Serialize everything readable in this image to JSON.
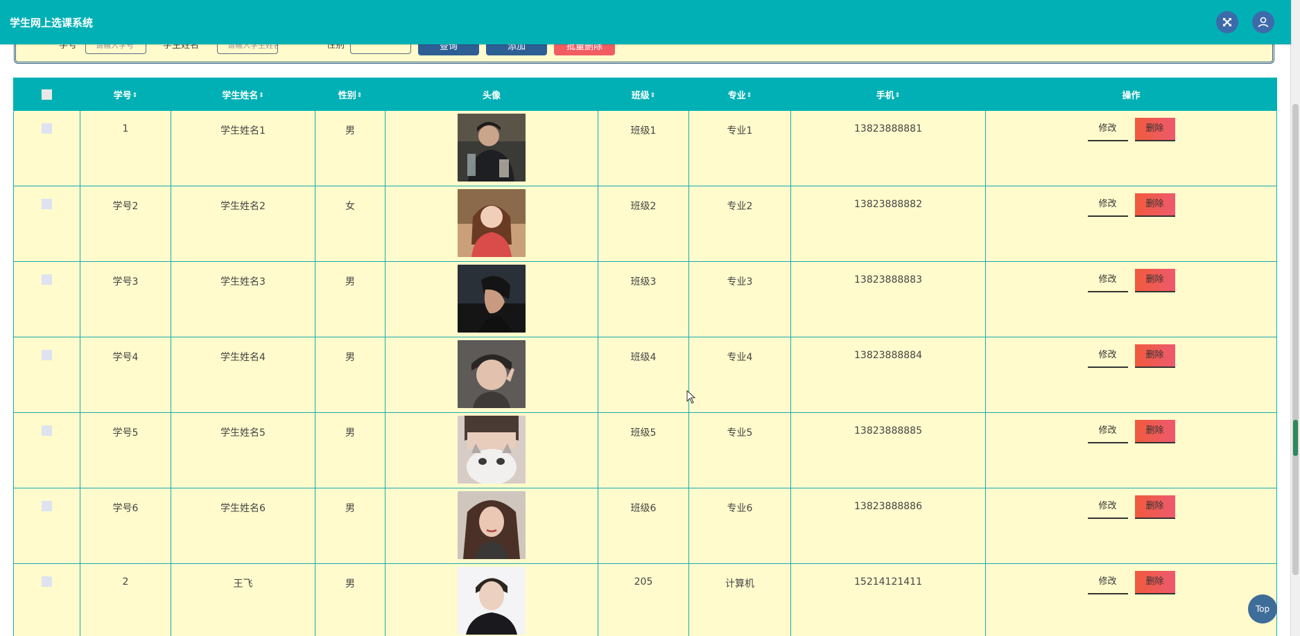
{
  "app": {
    "title": "学生网上选课系统"
  },
  "header": {
    "fullscreen_icon": "expand-icon",
    "user_icon": "user-icon",
    "accent_color": "#00b0b5"
  },
  "search": {
    "student_id_label": "学号",
    "student_id_placeholder": "请输入学号",
    "student_name_label": "学生姓名",
    "student_name_placeholder": "请输入学生姓名",
    "gender_label": "性别",
    "query_label": "查询",
    "add_label": "添加",
    "batch_delete_label": "批量删除"
  },
  "table": {
    "columns": {
      "student_id": "学号",
      "student_name": "学生姓名",
      "gender": "性别",
      "avatar": "头像",
      "class": "班级",
      "major": "专业",
      "phone": "手机",
      "actions": "操作"
    },
    "sort_indicator": "⇕",
    "edit_label": "修改",
    "delete_label": "删除",
    "rows": [
      {
        "student_id": "1",
        "student_name": "学生姓名1",
        "gender": "男",
        "class": "班级1",
        "major": "专业1",
        "phone": "13823888881"
      },
      {
        "student_id": "学号2",
        "student_name": "学生姓名2",
        "gender": "女",
        "class": "班级2",
        "major": "专业2",
        "phone": "13823888882"
      },
      {
        "student_id": "学号3",
        "student_name": "学生姓名3",
        "gender": "男",
        "class": "班级3",
        "major": "专业3",
        "phone": "13823888883"
      },
      {
        "student_id": "学号4",
        "student_name": "学生姓名4",
        "gender": "男",
        "class": "班级4",
        "major": "专业4",
        "phone": "13823888884"
      },
      {
        "student_id": "学号5",
        "student_name": "学生姓名5",
        "gender": "男",
        "class": "班级5",
        "major": "专业5",
        "phone": "13823888885"
      },
      {
        "student_id": "学号6",
        "student_name": "学生姓名6",
        "gender": "男",
        "class": "班级6",
        "major": "专业6",
        "phone": "13823888886"
      },
      {
        "student_id": "2",
        "student_name": "王飞",
        "gender": "男",
        "class": "205",
        "major": "计算机",
        "phone": "15214121411"
      }
    ]
  },
  "back_to_top": "Top"
}
